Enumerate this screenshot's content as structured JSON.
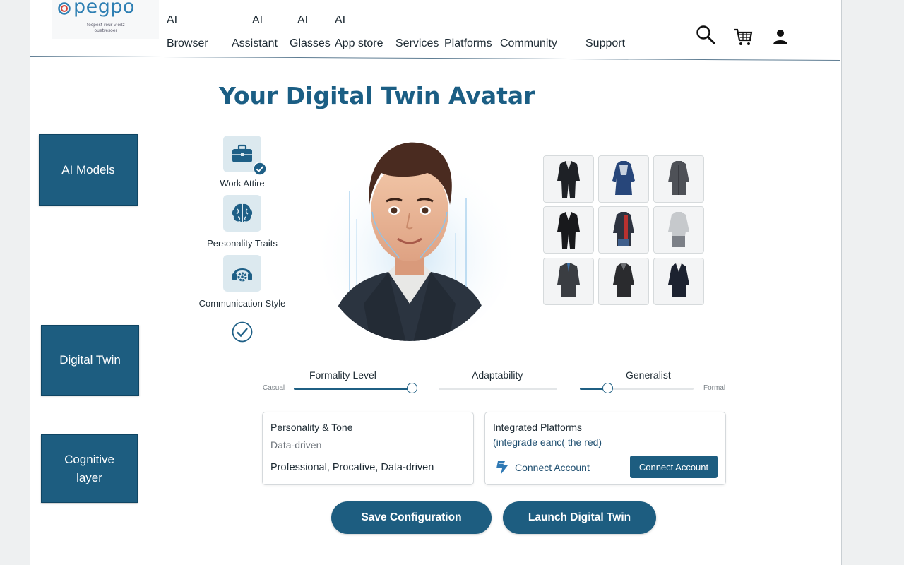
{
  "logo": {
    "text": "pegpo",
    "tagline_1": "fecpest rour vioilz",
    "tagline_2": "ouetresoer"
  },
  "nav": {
    "items": [
      {
        "prefix": "AI",
        "label": "Browser"
      },
      {
        "prefix": "AI",
        "label": "Assistant"
      },
      {
        "prefix": "AI",
        "label": "Glasses"
      },
      {
        "prefix": "AI",
        "label": "App store"
      },
      {
        "prefix": "",
        "label": "Services"
      },
      {
        "prefix": "",
        "label": "Platforms"
      },
      {
        "prefix": "",
        "label": "Community"
      },
      {
        "prefix": "",
        "label": "Support"
      }
    ],
    "icons": [
      "search-icon",
      "cart-icon",
      "user-icon"
    ]
  },
  "sidebar": {
    "items": [
      {
        "label": "AI Models"
      },
      {
        "label": "Digital Twin"
      },
      {
        "label": "Cognitive layer"
      }
    ]
  },
  "main": {
    "title": "Your Digital Twin Avatar",
    "traits": [
      {
        "label": "Work Attire",
        "icon": "briefcase-icon",
        "checked": true
      },
      {
        "label": "Personality Traits",
        "icon": "brain-icon",
        "checked": false
      },
      {
        "label": "Communication Style",
        "icon": "headset-gear-icon",
        "checked": false
      }
    ],
    "outfits_count_label": "",
    "sliders": {
      "left_min_label": "Casual",
      "right_max_label": "Formal",
      "items": [
        {
          "label": "Formality Level",
          "value": 1.0
        },
        {
          "label": "Adaptability",
          "value": 0.0
        },
        {
          "label": "Generalist",
          "value": 0.24
        }
      ]
    },
    "personality_card": {
      "title": "Personality & Tone",
      "subtitle": "Data-driven",
      "value": "Professional, Procative, Data-driven"
    },
    "platforms_card": {
      "title": "Integrated Platforms",
      "subtitle": "(integrade eanc( the red)",
      "link_label": "Connect Account",
      "button_label": "Connect Account"
    },
    "actions": {
      "save_label": "Save Configuration",
      "launch_label": "Launch Digital Twin"
    }
  },
  "colors": {
    "accent": "#1d5d80",
    "title": "#1b5e84",
    "icon_bg": "#dce9ef"
  }
}
